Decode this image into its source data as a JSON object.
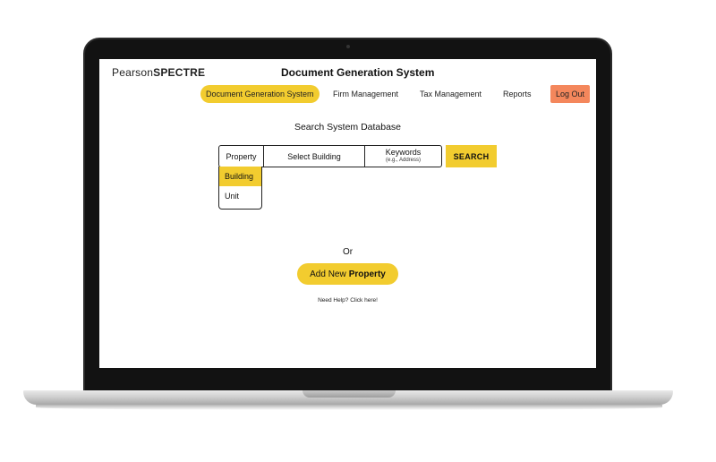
{
  "header": {
    "logo_light": "Pearson",
    "logo_bold": "SPECTRE",
    "title": "Document Generation System"
  },
  "nav": {
    "items": [
      {
        "label": "Document Generation System",
        "active": true
      },
      {
        "label": "Firm Management",
        "active": false
      },
      {
        "label": "Tax Management",
        "active": false
      },
      {
        "label": "Reports",
        "active": false
      }
    ],
    "logout": "Log Out"
  },
  "search": {
    "title": "Search System Database",
    "type_value": "Property",
    "building_label": "Select Building",
    "keywords_label": "Keywords",
    "keywords_hint": "(e.g., Address)",
    "button": "SEARCH",
    "dropdown_options": [
      {
        "label": "Building",
        "selected": true
      },
      {
        "label": "Unit",
        "selected": false
      }
    ]
  },
  "alt": {
    "or": "Or",
    "add_prefix": "Add New",
    "add_bold": "Property",
    "help": "Need Help? Click here!"
  },
  "colors": {
    "accent": "#f2cc2f",
    "logout": "#f4875c",
    "bezel": "#121212"
  }
}
